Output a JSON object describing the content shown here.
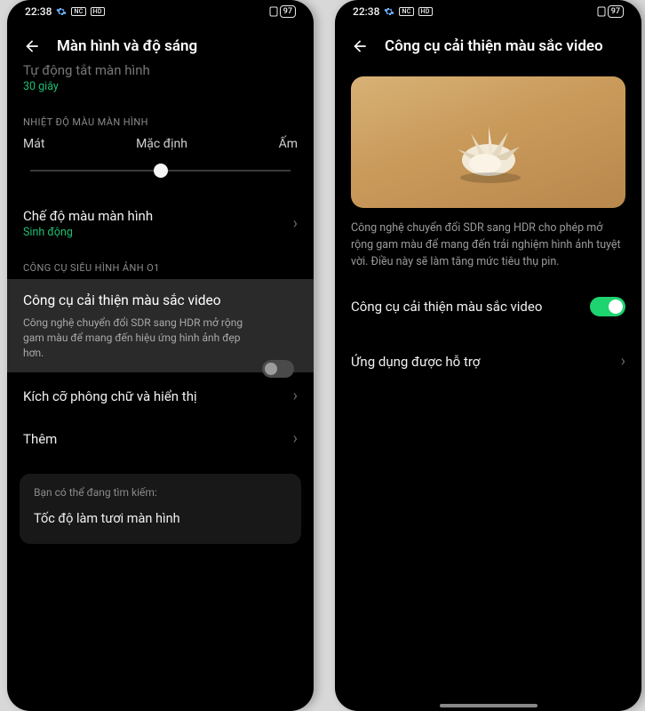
{
  "status": {
    "time": "22:38",
    "battery_pct": "97"
  },
  "left": {
    "title": "Màn hình và độ sáng",
    "auto_off_title": "Tự động tắt màn hình",
    "auto_off_value": "30 giây",
    "section_temp": "NHIỆT ĐỘ MÀU MÀN HÌNH",
    "temp_cool": "Mát",
    "temp_default": "Mặc định",
    "temp_warm": "Ấm",
    "color_mode_title": "Chế độ màu màn hình",
    "color_mode_value": "Sinh động",
    "section_o1": "CÔNG CỤ SIÊU HÌNH ẢNH O1",
    "enh_title": "Công cụ cải thiện màu sắc video",
    "enh_desc": "Công nghệ chuyển đổi SDR sang HDR mở rộng gam màu để mang đến hiệu ứng hình ảnh đẹp hơn.",
    "font_title": "Kích cỡ phông chữ và hiển thị",
    "more_title": "Thêm",
    "suggest_label": "Bạn có thể đang tìm kiếm:",
    "suggest_item": "Tốc độ làm tươi màn hình"
  },
  "right": {
    "title": "Công cụ cải thiện màu sắc video",
    "desc": "Công nghệ chuyển đổi SDR sang HDR cho phép mở rộng gam màu để mang đến trải nghiệm hình ảnh tuyệt vời. Điều này sẽ làm tăng mức tiêu thụ pin.",
    "toggle_label": "Công cụ cải thiện màu sắc video",
    "supported_label": "Ứng dụng được hỗ trợ"
  }
}
